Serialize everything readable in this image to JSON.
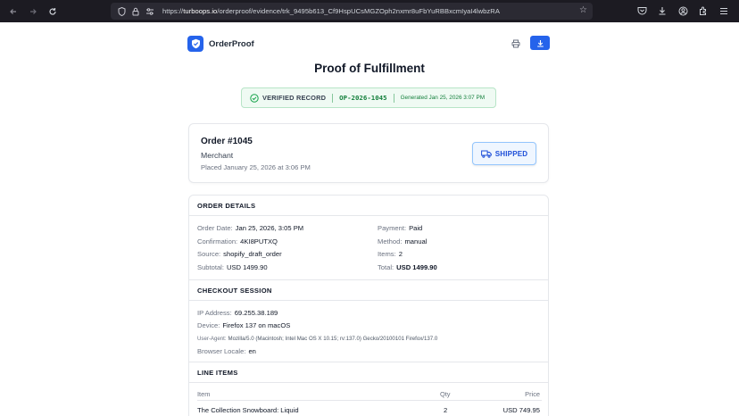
{
  "browser": {
    "url_protocol": "https://",
    "url_host": "turboops.io",
    "url_path": "/orderproof/evidence/trk_9495b613_Cf9HspUCsMGZOph2nxmr8uFbYuRBBxcmIyaI4lwbzRA"
  },
  "header": {
    "brand": "OrderProof"
  },
  "title": "Proof of Fulfillment",
  "verified": {
    "label": "VERIFIED RECORD",
    "record_id": "OP-2026-1045",
    "generated": "Generated Jan 25, 2026 3:07 PM"
  },
  "order": {
    "number": "Order #1045",
    "merchant": "Merchant",
    "placed": "Placed January 25, 2026 at 3:06 PM",
    "status": "SHIPPED"
  },
  "order_details": {
    "heading": "ORDER DETAILS",
    "left": [
      {
        "k": "Order Date:",
        "v": "Jan 25, 2026, 3:05 PM"
      },
      {
        "k": "Confirmation:",
        "v": "4KI8PUTXQ"
      },
      {
        "k": "Source:",
        "v": "shopify_draft_order"
      },
      {
        "k": "Subtotal:",
        "v": "USD 1499.90"
      }
    ],
    "right": [
      {
        "k": "Payment:",
        "v": "Paid"
      },
      {
        "k": "Method:",
        "v": "manual"
      },
      {
        "k": "Items:",
        "v": "2"
      },
      {
        "k": "Total:",
        "v": "USD 1499.90"
      }
    ]
  },
  "checkout": {
    "heading": "CHECKOUT SESSION",
    "ip_label": "IP Address:",
    "ip": "69.255.38.189",
    "device_label": "Device:",
    "device": "Firefox 137 on macOS",
    "ua_label": "User-Agent:",
    "ua": "Mozilla/5.0 (Macintosh; Intel Mac OS X 10.15; rv:137.0) Gecko/20100101 Firefox/137.0",
    "locale_label": "Browser Locale:",
    "locale": "en"
  },
  "line_items": {
    "heading": "LINE ITEMS",
    "columns": [
      "Item",
      "Qty",
      "Price"
    ],
    "rows": [
      {
        "item": "The Collection Snowboard: Liquid",
        "qty": "2",
        "price": "USD 749.95"
      }
    ]
  },
  "colors": {
    "accent": "#2563eb",
    "verified_green": "#15803d",
    "shipped_blue": "#1d4ed8"
  }
}
